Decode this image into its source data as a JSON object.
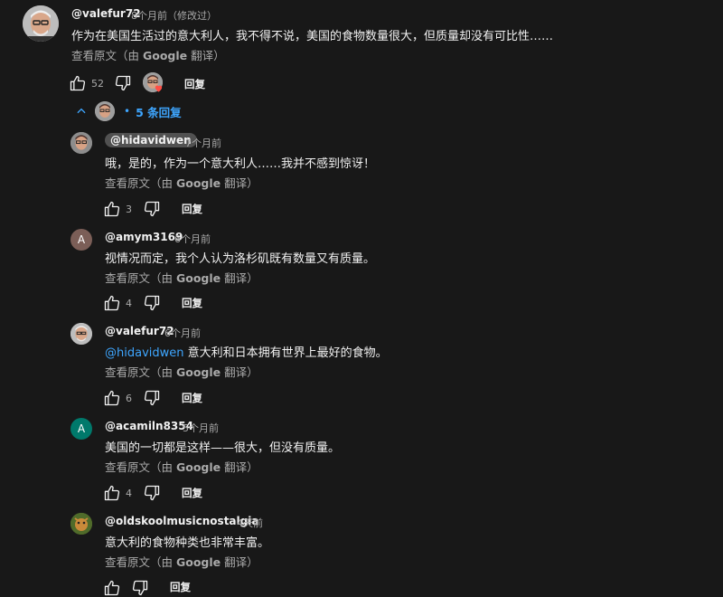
{
  "top_comment": {
    "username": "@valefur72",
    "time": "8个月前（修改过）",
    "text": "作为在美国生活过的意大利人，我不得不说，美国的食物数量很大，但质量却没有可比性……",
    "translate_prefix": "查看原文（由 ",
    "translate_brand": "Google",
    "translate_suffix": " 翻译）",
    "likes": "52",
    "reply_label": "回复"
  },
  "replies_toggle": {
    "label": "5 条回复"
  },
  "replies": [
    {
      "username": "@hidavidwen",
      "time": "7个月前",
      "mention": "",
      "text": "哦，是的，作为一个意大利人……我并不感到惊讶！",
      "likes": "3",
      "avatar": "photo"
    },
    {
      "username": "@amym3169",
      "time": "6个月前",
      "mention": "",
      "text": "视情况而定，我个人认为洛杉矶既有数量又有质量。",
      "likes": "4",
      "avatar": "A",
      "avatar_color": "#7b5e57"
    },
    {
      "username": "@valefur72",
      "time": "6个月前",
      "mention": "@hidavidwen",
      "text": " 意大利和日本拥有世界上最好的食物。",
      "likes": "6",
      "avatar": "photo"
    },
    {
      "username": "@acamiln8354",
      "time": "5个月前",
      "mention": "",
      "text": "美国的一切都是这样——很大，但没有质量。",
      "likes": "4",
      "avatar": "A",
      "avatar_color": "#00796b"
    },
    {
      "username": "@oldskoolmusicnostalgia",
      "time": "4天前",
      "mention": "",
      "text": "意大利的食物种类也非常丰富。",
      "likes": "",
      "avatar": "photo-green"
    }
  ],
  "reply_label": "回复",
  "translate_prefix": "查看原文（由 ",
  "translate_brand": "Google",
  "translate_suffix": " 翻译）",
  "colors": {
    "background": "#181818",
    "link": "#3ea6ff",
    "muted": "#aaaaaa",
    "text": "#f1f1f1"
  }
}
